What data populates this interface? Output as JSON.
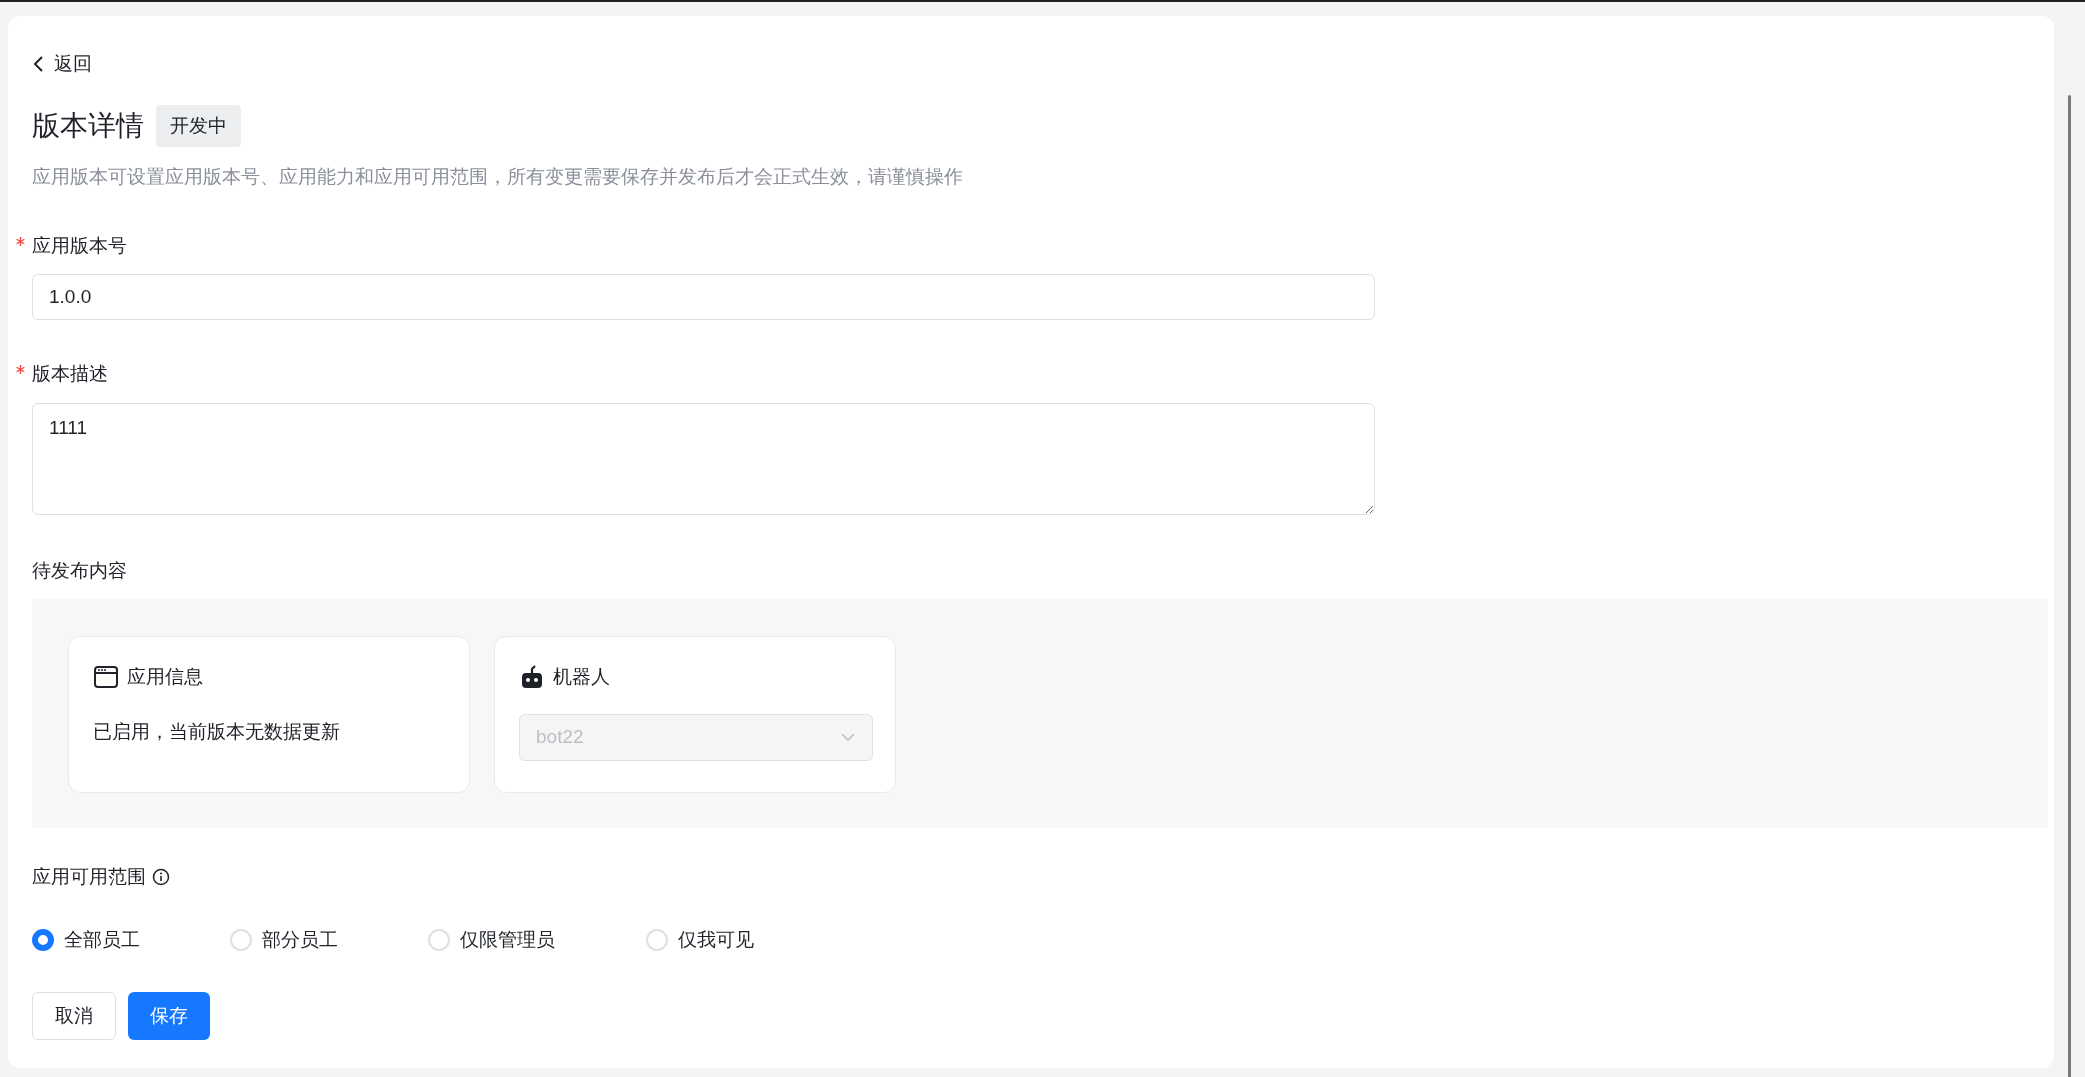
{
  "back_link": {
    "label": "返回"
  },
  "header": {
    "title": "版本详情",
    "status_tag": "开发中",
    "description": "应用版本可设置应用版本号、应用能力和应用可用范围，所有变更需要保存并发布后才会正式生效，请谨慎操作"
  },
  "fields": [
    {
      "kind": "input",
      "label": "应用版本号",
      "required": true,
      "value": "1.0.0"
    },
    {
      "kind": "textarea",
      "label": "版本描述",
      "required": true,
      "value": "1111"
    }
  ],
  "pending_content": {
    "label": "待发布内容",
    "cards": [
      {
        "kind": "text",
        "title": "应用信息",
        "text": "已启用，当前版本无数据更新"
      },
      {
        "kind": "select",
        "title": "机器人",
        "value": "bot22",
        "disabled": true
      }
    ]
  },
  "visibility": {
    "label": "应用可用范围",
    "options": [
      {
        "label": "全部员工",
        "selected": true
      },
      {
        "label": "部分员工",
        "selected": false
      },
      {
        "label": "仅限管理员",
        "selected": false
      },
      {
        "label": "仅我可见",
        "selected": false
      }
    ]
  },
  "buttons": [
    {
      "kind": "secondary",
      "label": "取消"
    },
    {
      "kind": "primary",
      "label": "保存"
    }
  ]
}
